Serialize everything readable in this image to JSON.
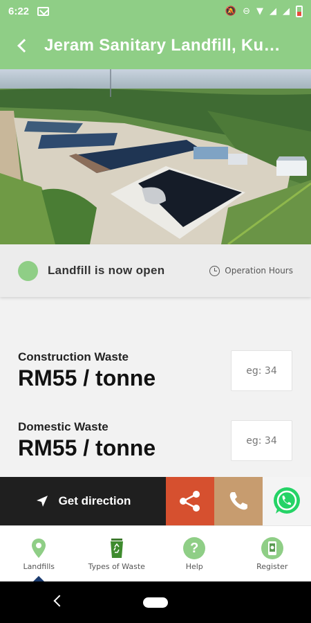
{
  "status_bar": {
    "time": "6:22"
  },
  "app_bar": {
    "title": "Jeram Sanitary Landfill, Kuala Selangor"
  },
  "status": {
    "open_text": "Landfill is now open",
    "operation_hours_label": "Operation Hours",
    "open_color": "#8fce86"
  },
  "waste_types": [
    {
      "label": "Construction Waste",
      "price": "RM55 / tonne",
      "placeholder": "eg: 34"
    },
    {
      "label": "Domestic Waste",
      "price": "RM55 / tonne",
      "placeholder": "eg: 34"
    }
  ],
  "actions": {
    "direction_label": "Get direction",
    "share_color": "#d6502f",
    "call_color": "#c79c6f"
  },
  "bottom_nav": {
    "items": [
      {
        "label": "Landfills",
        "icon": "location-pin-icon",
        "active": true
      },
      {
        "label": "Types of Waste",
        "icon": "recycle-bin-icon",
        "active": false
      },
      {
        "label": "Help",
        "icon": "help-icon",
        "active": false
      },
      {
        "label": "Register",
        "icon": "register-phone-icon",
        "active": false
      }
    ]
  },
  "colors": {
    "primary": "#8fce86",
    "dark": "#1f1f1f",
    "whatsapp": "#25d366"
  }
}
